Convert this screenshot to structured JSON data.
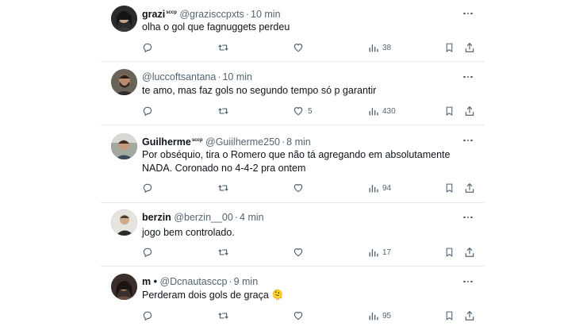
{
  "tweets": [
    {
      "name": "grazi",
      "badge": "sccp",
      "handle": "@grazisccpxts",
      "separator": "·",
      "time": "10 min",
      "text": "olha o gol que fagnuggets perdeu",
      "reply_count": "",
      "retweet_count": "",
      "like_count": "",
      "view_count": "38",
      "avatar": "avatar-dark-hair"
    },
    {
      "name": "",
      "badge": "",
      "handle": "@luccoftsantana",
      "separator": "·",
      "time": "10 min",
      "text": "te amo, mas faz gols no segundo tempo só p garantir",
      "reply_count": "",
      "retweet_count": "",
      "like_count": "5",
      "view_count": "430",
      "avatar": "avatar-bearded-man"
    },
    {
      "name": "Guilherme",
      "badge": "sccp",
      "handle": "@Guiilherme250",
      "separator": "·",
      "time": "8 min",
      "text": "Por obséquio, tira o Romero que não tá agregando em absolutamente NADA. Coronado no 4-4-2 pra ontem",
      "reply_count": "",
      "retweet_count": "",
      "like_count": "",
      "view_count": "94",
      "avatar": "avatar-man-outdoors"
    },
    {
      "name": "berzin",
      "badge": "",
      "handle": "@berzin__00",
      "separator": "·",
      "time": "4 min",
      "text": "jogo bem controlado.",
      "reply_count": "",
      "retweet_count": "",
      "like_count": "",
      "view_count": "17",
      "avatar": "avatar-man-light"
    },
    {
      "name": "m •",
      "badge": "",
      "handle": "@Dcnautasccp",
      "separator": "·",
      "time": "9 min",
      "text": "Perderam dois gols de graça 🫠",
      "reply_count": "",
      "retweet_count": "",
      "like_count": "",
      "view_count": "95",
      "avatar": "avatar-woman-dark-hair"
    }
  ],
  "icons": {
    "reply": "reply-icon",
    "retweet": "retweet-icon",
    "like": "heart-icon",
    "views": "bar-chart-icon",
    "bookmark": "bookmark-icon",
    "share": "share-icon",
    "more": "more-icon"
  },
  "colors": {
    "text": "#0f1419",
    "secondary": "#536471",
    "divider": "#e9ecef"
  }
}
